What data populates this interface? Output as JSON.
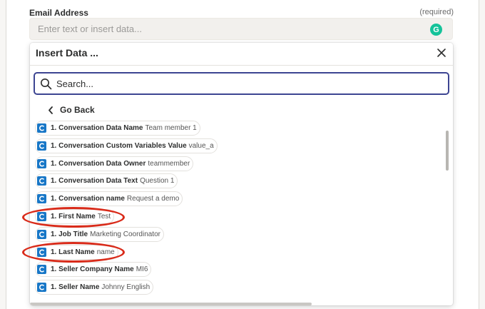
{
  "field": {
    "label": "Email Address",
    "required_text": "(required)",
    "placeholder": "Enter text or insert data..."
  },
  "popover": {
    "title": "Insert Data ...",
    "search_placeholder": "Search...",
    "go_back_label": "Go Back"
  },
  "items": [
    {
      "key": "1. Conversation Data Name",
      "value": "Team member 1",
      "highlighted": false
    },
    {
      "key": "1. Conversation Custom Variables Value",
      "value": "value_a",
      "highlighted": false
    },
    {
      "key": "1. Conversation Data Owner",
      "value": "teammember",
      "highlighted": false
    },
    {
      "key": "1. Conversation Data Text",
      "value": "Question 1",
      "highlighted": false
    },
    {
      "key": "1. Conversation name",
      "value": "Request a demo",
      "highlighted": false
    },
    {
      "key": "1. First Name",
      "value": "Test",
      "highlighted": true
    },
    {
      "key": "1. Job Title",
      "value": "Marketing Coordinator",
      "highlighted": false
    },
    {
      "key": "1. Last Name",
      "value": "name",
      "highlighted": true
    },
    {
      "key": "1. Seller Company Name",
      "value": "MI6",
      "highlighted": false
    },
    {
      "key": "1. Seller Name",
      "value": "Johnny English",
      "highlighted": false
    }
  ],
  "icons": {
    "app_icon": "app-c-icon",
    "search_icon": "search-icon",
    "close_icon": "close-icon",
    "back_icon": "chevron-left-icon",
    "grammarly_icon": "grammarly-icon"
  },
  "colors": {
    "search_border": "#3d4592",
    "app_icon": "#1877c7",
    "annotation": "#d92b1a",
    "grammarly": "#15c39a"
  }
}
